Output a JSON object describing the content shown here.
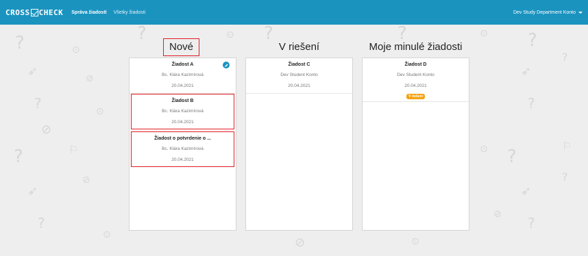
{
  "navbar": {
    "brand_left": "CROSS",
    "brand_right": "CHECK",
    "links": [
      "Správa žiadostí",
      "Všetky žiadosti"
    ],
    "user": "Dev Study Department Konto"
  },
  "columns": [
    {
      "title": "Nové",
      "cards": [
        {
          "title": "Žiadost A",
          "name": "Bc. Klára Kazimírová",
          "date": "20.04.2021"
        },
        {
          "title": "Žiadost B",
          "name": "Bc. Klára Kazimírová",
          "date": "20.04.2021"
        },
        {
          "title": "Žiadost o potvrdenie o ...",
          "name": "Bc. Klára Kazimírová",
          "date": "20.04.2021"
        }
      ]
    },
    {
      "title": "V riešení",
      "cards": [
        {
          "title": "Žiadost C",
          "name": "Dev Student Konto",
          "date": "20.04.2021"
        }
      ]
    },
    {
      "title": "Moje minulé žiadosti",
      "cards": [
        {
          "title": "Žiadost D",
          "name": "Dev Student Konto",
          "date": "20.04.2021",
          "badge": "V riešení"
        }
      ]
    }
  ],
  "colors": {
    "navbar": "#1a93bf",
    "highlight": "#e01b24",
    "badge": "#f5a20f"
  }
}
